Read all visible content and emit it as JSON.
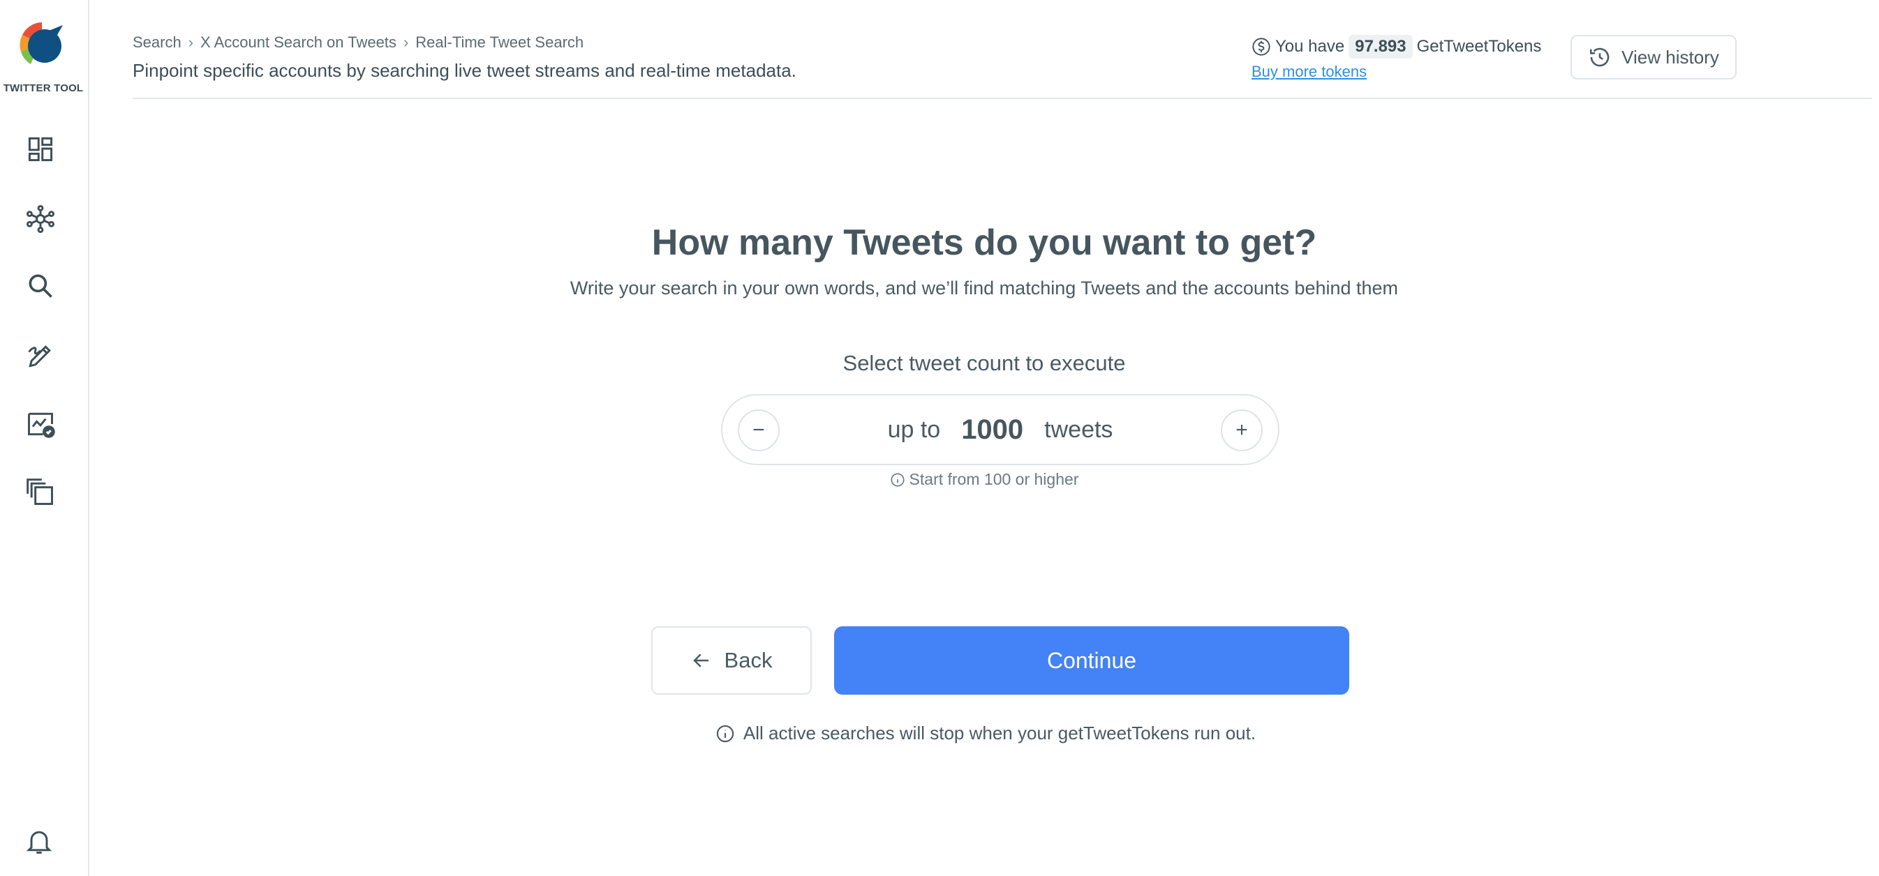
{
  "app": {
    "name": "TWITTER TOOL"
  },
  "colors": {
    "accent": "#4382f7",
    "link": "#2f8fe3",
    "text": "#4a5a63"
  },
  "sidebar": {
    "items": [
      {
        "icon": "dashboard-icon"
      },
      {
        "icon": "network-icon"
      },
      {
        "icon": "search-icon"
      },
      {
        "icon": "edit-icon"
      },
      {
        "icon": "analytics-check-icon"
      },
      {
        "icon": "copy-icon"
      }
    ],
    "bottom": {
      "icon": "bell-icon"
    }
  },
  "header": {
    "breadcrumb": [
      "Search",
      "X Account Search on Tweets",
      "Real-Time Tweet Search"
    ],
    "subtitle": "Pinpoint specific accounts by searching live tweet streams and real-time metadata.",
    "tokens_prefix": "You have",
    "tokens_value": "97.893",
    "tokens_suffix": "GetTweetTokens",
    "buy_link": "Buy more tokens",
    "history_label": "View history"
  },
  "main": {
    "title": "How many Tweets do you want to get?",
    "subtitle": "Write your search in your own words, and we’ll find matching Tweets and the accounts behind them",
    "select_label": "Select tweet count to execute",
    "stepper": {
      "prefix": "up to",
      "value": "1000",
      "suffix": "tweets",
      "minus": "−",
      "plus": "+"
    },
    "hint": "Start from 100 or higher",
    "back_label": "Back",
    "continue_label": "Continue",
    "warning": "All active searches will stop when your getTweetTokens run out."
  }
}
